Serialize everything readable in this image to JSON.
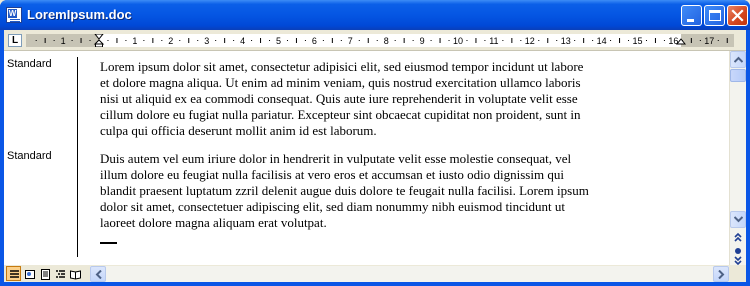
{
  "window": {
    "title": "LoremIpsum.doc",
    "app_icon": "word-document-icon",
    "controls": [
      "minimize-icon",
      "maximize-icon",
      "close-icon"
    ]
  },
  "ruler": {
    "tab_selector": "L",
    "numbers": [
      "1",
      "1",
      "2",
      "3",
      "4",
      "5",
      "6",
      "7",
      "8",
      "9",
      "10",
      "11",
      "12",
      "13",
      "14",
      "15",
      "16",
      "17"
    ]
  },
  "document": {
    "paragraphs": [
      {
        "style": "Standard",
        "text": "Lorem ipsum dolor sit amet, consectetur adipisici elit, sed eiusmod tempor incidunt ut labore\net dolore magna aliqua. Ut enim ad minim veniam, quis nostrud exercitation ullamco laboris\nnisi ut aliquid ex ea commodi consequat. Quis aute iure reprehenderit in voluptate velit esse\ncillum dolore eu fugiat nulla pariatur. Excepteur sint obcaecat cupiditat non proident, sunt in\nculpa qui officia deserunt mollit anim id est laborum."
      },
      {
        "style": "Standard",
        "text": "Duis autem vel eum iriure dolor in hendrerit in vulputate velit esse molestie consequat, vel\nillum dolore eu feugiat nulla facilisis at vero eros et accumsan et iusto odio dignissim qui\nblandit praesent luptatum zzril delenit augue duis dolore te feugait nulla facilisi. Lorem ipsum\ndolor sit amet, consectetuer adipiscing elit, sed diam nonummy nibh euismod tincidunt ut\nlaoreet dolore magna aliquam erat volutpat."
      }
    ]
  },
  "view_buttons": [
    "normal-view-icon",
    "web-layout-icon",
    "print-layout-icon",
    "outline-view-icon",
    "reading-layout-icon"
  ],
  "scrollbars": {
    "vertical": [
      "scroll-up-icon",
      "scroll-down-icon",
      "previous-page-icon",
      "select-browse-object-icon",
      "next-page-icon"
    ],
    "horizontal": [
      "scroll-left-icon",
      "scroll-right-icon"
    ]
  },
  "colors": {
    "titlebar": "#0556e3",
    "close_button": "#d4451d",
    "active_view": "#fbd089"
  }
}
